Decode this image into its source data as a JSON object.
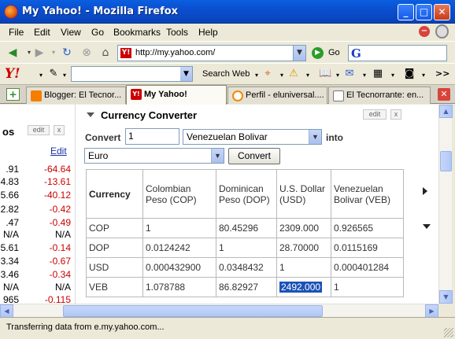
{
  "window": {
    "title": "My Yahoo! - Mozilla Firefox"
  },
  "menu": [
    "File",
    "Edit",
    "View",
    "Go",
    "Bookmarks",
    "Tools",
    "Help"
  ],
  "nav": {
    "url": "http://my.yahoo.com/",
    "go_label": "Go"
  },
  "yahoo_toolbar": {
    "search_web_label": "Search Web"
  },
  "tabs": [
    {
      "label": "Blogger: El Tecnor..."
    },
    {
      "label": "My Yahoo!"
    },
    {
      "label": "Perfil - eluniversal...."
    },
    {
      "label": "El Tecnorrante: en..."
    }
  ],
  "left_panel": {
    "title": "os",
    "edit_btn": "edit",
    "close_btn": "x",
    "edit_link": "Edit",
    "rows": [
      {
        "a": ".91",
        "b": "-64.64"
      },
      {
        "a": "4.83",
        "b": "-13.61"
      },
      {
        "a": "5.66",
        "b": "-40.12"
      },
      {
        "a": "2.82",
        "b": "-0.42"
      },
      {
        "a": ".47",
        "b": "-0.49"
      },
      {
        "a": "N/A",
        "b": "N/A"
      },
      {
        "a": "5.61",
        "b": "-0.14"
      },
      {
        "a": "3.34",
        "b": "-0.67"
      },
      {
        "a": "3.46",
        "b": "-0.34"
      },
      {
        "a": "N/A",
        "b": "N/A"
      },
      {
        "a": "965",
        "b": "-0.115"
      }
    ]
  },
  "converter": {
    "title": "Currency Converter",
    "edit_btn": "edit",
    "close_btn": "x",
    "convert_label": "Convert",
    "amount": "1",
    "from_currency": "Venezuelan Bolivar",
    "into_label": "into",
    "to_currency": "Euro",
    "convert_button": "Convert",
    "table": {
      "corner": "Currency",
      "headers": [
        "Colombian Peso (COP)",
        "Dominican Peso (DOP)",
        "U.S. Dollar (USD)",
        "Venezuelan Bolivar (VEB)"
      ],
      "rows": [
        {
          "code": "COP",
          "vals": [
            "1",
            "80.45296",
            "2309.000",
            "0.926565"
          ]
        },
        {
          "code": "DOP",
          "vals": [
            "0.0124242",
            "1",
            "28.70000",
            "0.0115169"
          ]
        },
        {
          "code": "USD",
          "vals": [
            "0.000432900",
            "0.0348432",
            "1",
            "0.000401284"
          ]
        },
        {
          "code": "VEB",
          "vals": [
            "1.078788",
            "86.82927",
            "2492.000",
            "1"
          ]
        }
      ]
    }
  },
  "status": {
    "text": "Transferring data from e.my.yahoo.com..."
  }
}
